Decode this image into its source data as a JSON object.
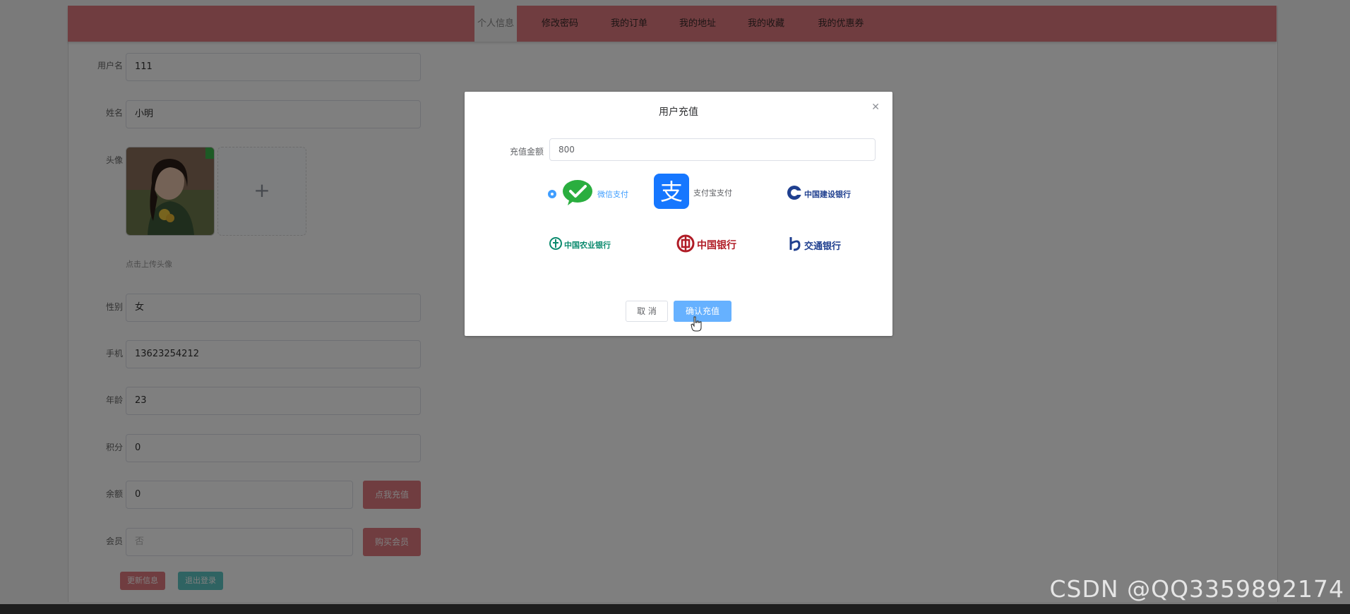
{
  "nav": {
    "tabs": [
      {
        "label": "个人信息"
      },
      {
        "label": "修改密码"
      },
      {
        "label": "我的订单"
      },
      {
        "label": "我的地址"
      },
      {
        "label": "我的收藏"
      },
      {
        "label": "我的优惠券"
      }
    ],
    "active_index": 0
  },
  "form": {
    "username": {
      "label": "用户名",
      "value": "111"
    },
    "name": {
      "label": "姓名",
      "value": "小明"
    },
    "avatar": {
      "label": "头像",
      "hint": "点击上传头像"
    },
    "gender": {
      "label": "性别",
      "value": "女"
    },
    "phone": {
      "label": "手机",
      "value": "13623254212"
    },
    "age": {
      "label": "年龄",
      "value": "23"
    },
    "points": {
      "label": "积分",
      "value": "0"
    },
    "balance": {
      "label": "余额",
      "value": "0",
      "button": "点我充值"
    },
    "vip": {
      "label": "会员",
      "placeholder": "否",
      "button": "购买会员"
    },
    "update_button": "更新信息",
    "logout_button": "退出登录"
  },
  "dialog": {
    "title": "用户充值",
    "amount_label": "充值金额",
    "amount_value": "800",
    "payment_options": [
      {
        "id": "wechat",
        "label": "微信支付",
        "selected": true
      },
      {
        "id": "alipay",
        "label": "支付宝支付",
        "selected": false
      },
      {
        "id": "ccb",
        "label": "中国建设银行",
        "selected": false
      },
      {
        "id": "abc",
        "label": "中国农业银行",
        "selected": false
      },
      {
        "id": "boc",
        "label": "中国银行",
        "selected": false
      },
      {
        "id": "bocom",
        "label": "交通银行",
        "selected": false
      }
    ],
    "cancel_label": "取 消",
    "confirm_label": "确认充值"
  },
  "watermark": "CSDN @QQ3359892174",
  "colors": {
    "nav": "#e07b80",
    "primary": "#409eff",
    "wechat": "#2aae3f",
    "alipay": "#1677ff",
    "ccb": "#1f3f8f",
    "abc": "#0a8a6d",
    "boc": "#b01c26",
    "bocom": "#1f3f8f"
  }
}
